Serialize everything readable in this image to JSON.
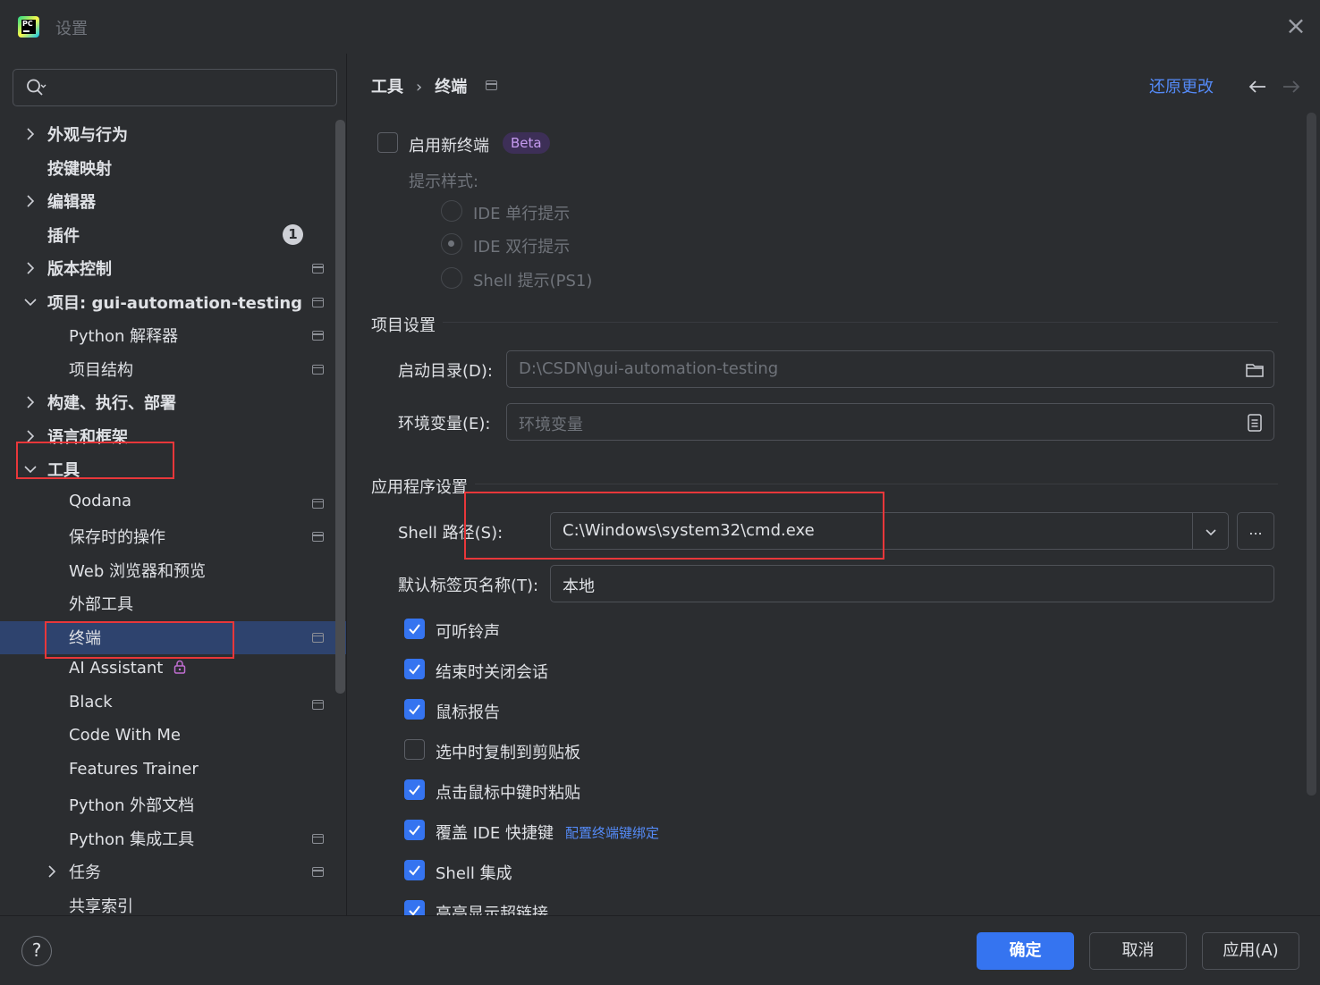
{
  "window": {
    "title": "设置",
    "app_icon": "pycharm-logo",
    "app_icon_text": "PC"
  },
  "search": {
    "value": "",
    "placeholder": ""
  },
  "sidebar": {
    "items": [
      {
        "label": "外观与行为",
        "bold": true,
        "expander": "collapsed"
      },
      {
        "label": "按键映射",
        "bold": true
      },
      {
        "label": "编辑器",
        "bold": true,
        "expander": "collapsed"
      },
      {
        "label": "插件",
        "bold": true,
        "badge": "1"
      },
      {
        "label": "版本控制",
        "bold": true,
        "expander": "collapsed"
      },
      {
        "label": "项目: gui-automation-testing",
        "bold": true,
        "expander": "expanded"
      },
      {
        "label": "Python 解释器"
      },
      {
        "label": "项目结构"
      },
      {
        "label": "构建、执行、部署",
        "bold": true,
        "expander": "collapsed"
      },
      {
        "label": "语言和框架",
        "bold": true,
        "expander": "collapsed"
      },
      {
        "label": "工具",
        "bold": true,
        "expander": "expanded"
      },
      {
        "label": "Qodana"
      },
      {
        "label": "保存时的操作"
      },
      {
        "label": "Web 浏览器和预览"
      },
      {
        "label": "外部工具"
      },
      {
        "label": "终端",
        "selected": true
      },
      {
        "label": "AI Assistant",
        "icon": "lock-icon"
      },
      {
        "label": "Black"
      },
      {
        "label": "Code With Me"
      },
      {
        "label": "Features Trainer"
      },
      {
        "label": "Python 外部文档"
      },
      {
        "label": "Python 集成工具"
      },
      {
        "label": "任务",
        "expander": "collapsed"
      },
      {
        "label": "共享索引"
      }
    ]
  },
  "header": {
    "breadcrumb": [
      "工具",
      "终端"
    ],
    "separator": "›",
    "reset_label": "还原更改"
  },
  "new_terminal": {
    "label": "启用新终端",
    "checked": false,
    "beta_label": "Beta",
    "prompt_style_label": "提示样式:",
    "options": [
      {
        "label": "IDE 单行提示",
        "selected": false
      },
      {
        "label": "IDE 双行提示",
        "selected": true
      },
      {
        "label": "Shell 提示(PS1)",
        "selected": false
      }
    ]
  },
  "project_settings": {
    "title": "项目设置",
    "start_dir_label": "启动目录(D):",
    "start_dir_placeholder": "D:\\CSDN\\gui-automation-testing",
    "env_label": "环境变量(E):",
    "env_placeholder": "环境变量"
  },
  "app_settings": {
    "title": "应用程序设置",
    "shell_path_label": "Shell 路径(S):",
    "shell_path_value": "C:\\Windows\\system32\\cmd.exe",
    "browse_label": "...",
    "tab_name_label": "默认标签页名称(T):",
    "tab_name_value": "本地",
    "options": [
      {
        "label": "可听铃声",
        "checked": true
      },
      {
        "label": "结束时关闭会话",
        "checked": true
      },
      {
        "label": "鼠标报告",
        "checked": true
      },
      {
        "label": "选中时复制到剪贴板",
        "checked": false
      },
      {
        "label": "点击鼠标中键时粘贴",
        "checked": true
      },
      {
        "label": "覆盖 IDE 快捷键",
        "checked": true,
        "link": "配置终端键绑定"
      },
      {
        "label": "Shell 集成",
        "checked": true
      },
      {
        "label": "高亮显示超链接",
        "checked": true
      }
    ]
  },
  "footer": {
    "help_label": "?",
    "ok_label": "确定",
    "cancel_label": "取消",
    "apply_label": "应用(A)"
  },
  "colors": {
    "accent": "#3574f0",
    "link": "#548af7",
    "selection": "#2e436e",
    "annotation": "#e8373a",
    "beta_text": "#c69bf0"
  }
}
